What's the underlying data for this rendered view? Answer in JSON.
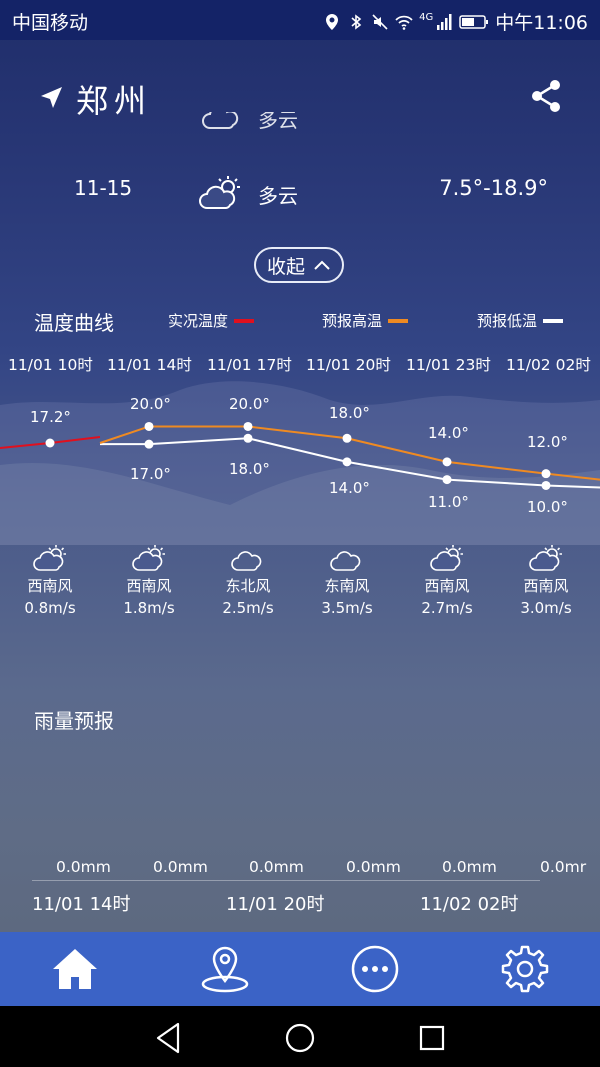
{
  "status_bar": {
    "carrier": "中国移动",
    "network": "4G",
    "time": "中午11:06"
  },
  "header": {
    "city": "郑州",
    "location_icon": "location-arrow-icon",
    "share_icon": "share-icon"
  },
  "daily": {
    "partial_condition": "多云",
    "date": "11-15",
    "condition": "多云",
    "range": "7.5°-18.9°"
  },
  "collapse_label": "收起",
  "temperature_curve": {
    "title": "温度曲线",
    "legend": [
      {
        "label": "实况温度",
        "color": "#e0101e"
      },
      {
        "label": "预报高温",
        "color": "#ef8a22"
      },
      {
        "label": "预报低温",
        "color": "#ffffff"
      }
    ],
    "times": [
      "11/01 10时",
      "11/01 14时",
      "11/01 17时",
      "11/01 20时",
      "11/01 23时",
      "11/02 02时"
    ],
    "high": [
      "17.2°",
      "20.0°",
      "20.0°",
      "18.0°",
      "14.0°",
      "12.0°"
    ],
    "low": [
      "17.0°",
      "18.0°",
      "14.0°",
      "11.0°",
      "10.0°"
    ]
  },
  "chart_data": {
    "type": "line",
    "title": "温度曲线",
    "x": [
      "11/01 10时",
      "11/01 14时",
      "11/01 17时",
      "11/01 20时",
      "11/01 23时",
      "11/02 02时"
    ],
    "series": [
      {
        "name": "预报高温",
        "values": [
          17.2,
          20.0,
          20.0,
          18.0,
          14.0,
          12.0
        ]
      },
      {
        "name": "预报低温",
        "values": [
          17.2,
          17.0,
          18.0,
          14.0,
          11.0,
          10.0
        ]
      },
      {
        "name": "实况温度",
        "values": [
          17.2,
          null,
          null,
          null,
          null,
          null
        ]
      }
    ],
    "ylim": [
      8,
      22
    ],
    "colors": {
      "实况温度": "#e0101e",
      "预报高温": "#ef8a22",
      "预报低温": "#ffffff"
    }
  },
  "wind": [
    {
      "icon": "partly-cloudy-icon",
      "dir": "西南风",
      "speed": "0.8m/s"
    },
    {
      "icon": "partly-cloudy-icon",
      "dir": "西南风",
      "speed": "1.8m/s"
    },
    {
      "icon": "cloudy-icon",
      "dir": "东北风",
      "speed": "2.5m/s"
    },
    {
      "icon": "cloudy-icon",
      "dir": "东南风",
      "speed": "3.5m/s"
    },
    {
      "icon": "partly-cloudy-icon",
      "dir": "西南风",
      "speed": "2.7m/s"
    },
    {
      "icon": "partly-cloudy-icon",
      "dir": "西南风",
      "speed": "3.0m/s"
    }
  ],
  "rain": {
    "title": "雨量预报",
    "values": [
      "0.0mm",
      "0.0mm",
      "0.0mm",
      "0.0mm",
      "0.0mm",
      "0.0mr"
    ],
    "times": [
      "11/01 14时",
      "11/01 20时",
      "11/02 02时"
    ]
  },
  "tabs": [
    {
      "name": "tab-home",
      "icon": "home-icon"
    },
    {
      "name": "tab-location",
      "icon": "map-pin-icon"
    },
    {
      "name": "tab-more",
      "icon": "more-icon"
    },
    {
      "name": "tab-settings",
      "icon": "gear-icon"
    }
  ],
  "nav": [
    "back-icon",
    "home-circle-icon",
    "recents-icon"
  ]
}
